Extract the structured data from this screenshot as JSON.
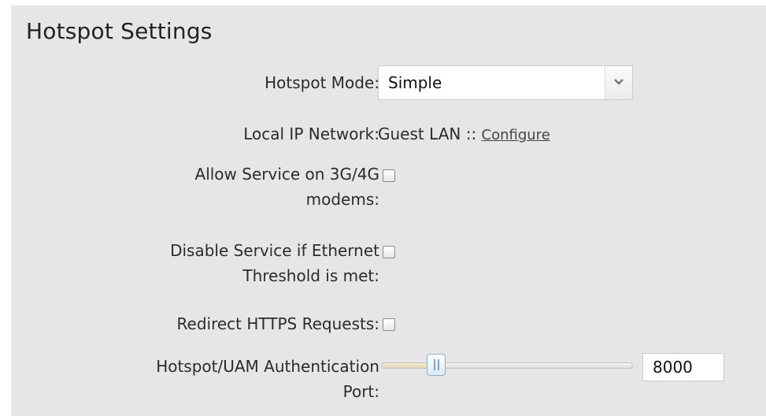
{
  "section": {
    "title": "Hotspot Settings"
  },
  "hotspot_mode": {
    "label": "Hotspot Mode:",
    "selected": "Simple"
  },
  "local_ip_network": {
    "label": "Local IP Network:",
    "value": "Guest LAN ::",
    "link_label": "Configure"
  },
  "allow_service_3g4g": {
    "label_line1": "Allow Service on 3G/4G",
    "label_line2": "modems:",
    "checked": false
  },
  "disable_service_ethernet": {
    "label_line1": "Disable Service if Ethernet",
    "label_line2": "Threshold is met:",
    "checked": false
  },
  "redirect_https": {
    "label": "Redirect HTTPS Requests:",
    "checked": false
  },
  "uam_port": {
    "label_line1": "Hotspot/UAM Authentication",
    "label_line2": "Port:",
    "value": "8000",
    "slider_fraction": 0.22
  },
  "colors": {
    "panel_bg": "#e6e6e6",
    "text": "#2b2b2b",
    "slider_handle_border": "#8fb0cf"
  }
}
